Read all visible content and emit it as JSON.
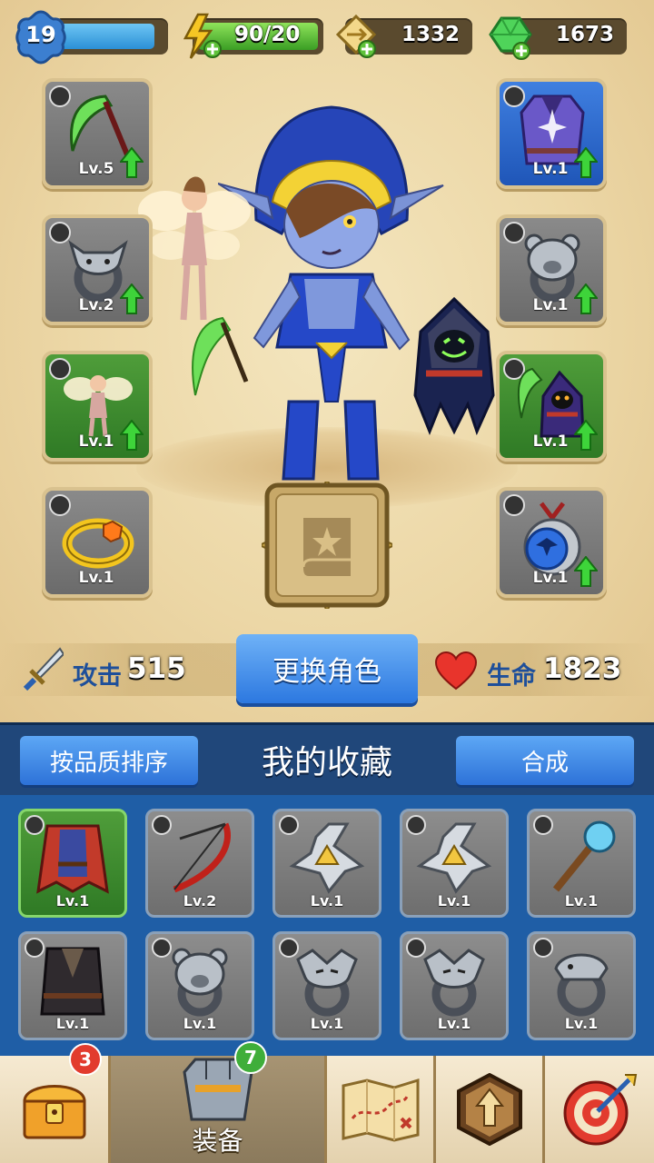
{
  "hud": {
    "level": "19",
    "xp_fraction": 0.92,
    "energy": "90/20",
    "coins": "1332",
    "gems": "1673"
  },
  "equipped_left": [
    {
      "level": "Lv.5",
      "item": "scythe",
      "rarity": "gray",
      "upgradable": true
    },
    {
      "level": "Lv.2",
      "item": "bull-ring",
      "rarity": "gray",
      "upgradable": true
    },
    {
      "level": "Lv.1",
      "item": "fairy-pet",
      "rarity": "green",
      "upgradable": true
    },
    {
      "level": "Lv.1",
      "item": "gold-bracelet",
      "rarity": "gray",
      "upgradable": false
    }
  ],
  "equipped_right": [
    {
      "level": "Lv.1",
      "item": "purple-armor",
      "rarity": "blue",
      "upgradable": true
    },
    {
      "level": "Lv.1",
      "item": "bear-ring",
      "rarity": "gray",
      "upgradable": true
    },
    {
      "level": "Lv.1",
      "item": "reaper-pet",
      "rarity": "green",
      "upgradable": true
    },
    {
      "level": "Lv.1",
      "item": "eagle-amulet",
      "rarity": "gray",
      "upgradable": true
    }
  ],
  "stats": {
    "attack_label": "攻击",
    "attack_value": "515",
    "hp_label": "生命",
    "hp_value": "1823",
    "change_character": "更换角色"
  },
  "collection": {
    "sort_button": "按品质排序",
    "title": "我的收藏",
    "merge_button": "合成",
    "items": [
      {
        "level": "Lv.1",
        "item": "red-robe",
        "rarity": "green"
      },
      {
        "level": "Lv.2",
        "item": "red-bow",
        "rarity": "gray"
      },
      {
        "level": "Lv.1",
        "item": "shuriken",
        "rarity": "gray"
      },
      {
        "level": "Lv.1",
        "item": "shuriken",
        "rarity": "gray"
      },
      {
        "level": "Lv.1",
        "item": "staff",
        "rarity": "gray"
      },
      {
        "level": "Lv.1",
        "item": "dark-vest",
        "rarity": "gray"
      },
      {
        "level": "Lv.1",
        "item": "bear-ring",
        "rarity": "gray"
      },
      {
        "level": "Lv.1",
        "item": "wolf-ring",
        "rarity": "gray"
      },
      {
        "level": "Lv.1",
        "item": "wolf-ring",
        "rarity": "gray"
      },
      {
        "level": "Lv.1",
        "item": "snake-ring",
        "rarity": "gray"
      }
    ]
  },
  "nav": {
    "chest_badge": "3",
    "equip_badge": "7",
    "equip_label": "装备"
  },
  "colors": {
    "attack_label": "#1e4f9a",
    "panel_blue": "#1f5ea6",
    "button_blue": "#2c78e0",
    "rarity_green": "#3a8a2e",
    "rarity_blue": "#2d6ad0",
    "badge_red": "#e23b2e",
    "badge_green": "#3fae3a"
  }
}
